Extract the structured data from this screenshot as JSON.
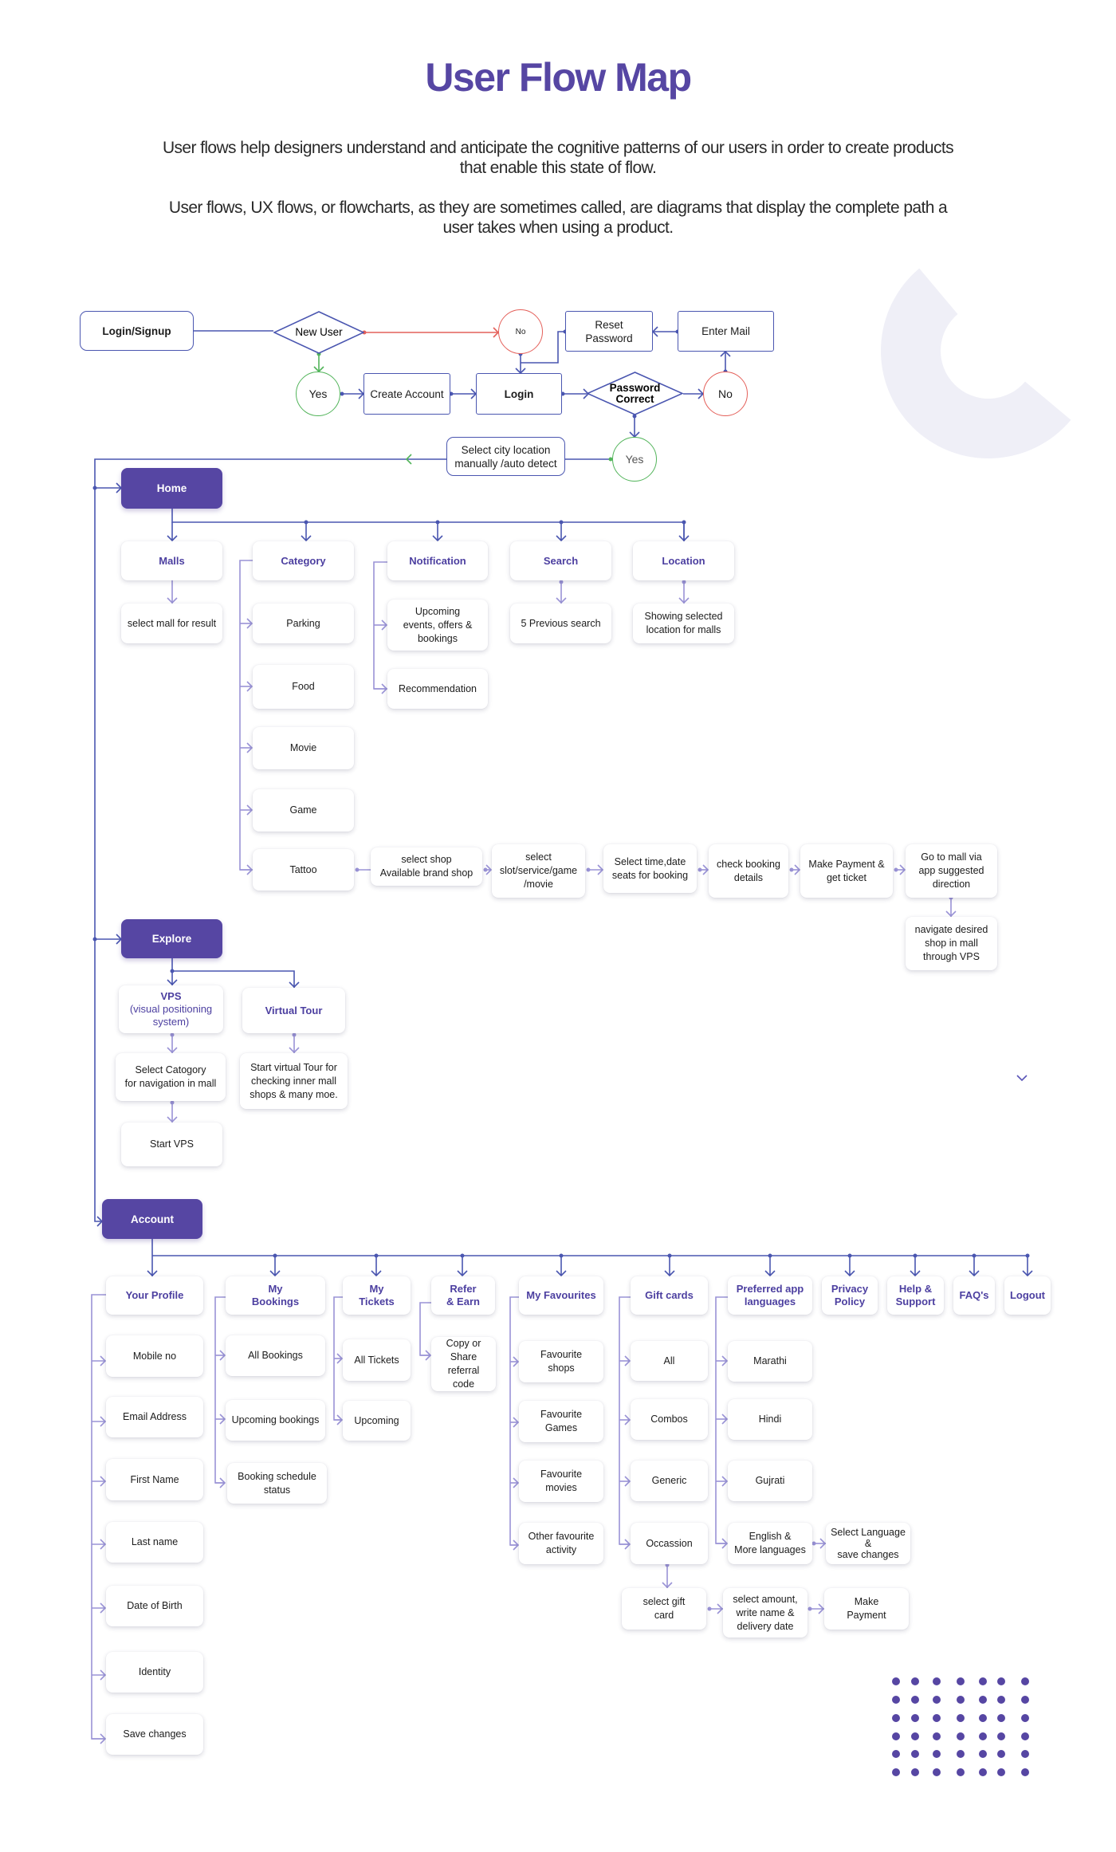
{
  "header": {
    "title": "User Flow Map",
    "paragraph_1": "User flows help designers understand and anticipate the cognitive patterns of our users in order to create products that enable this state of flow.",
    "paragraph_2": "User flows, UX flows, or flowcharts, as they are sometimes called, are diagrams that display the complete path a user takes when using a product."
  },
  "colors": {
    "primary": "#5646a3",
    "connector": "#4a56b0",
    "no_red": "#e4605a",
    "yes_green": "#52b45a",
    "decor": "#efeff7"
  },
  "auth_flow": {
    "login_signup": "Login/Signup",
    "new_user": "New User",
    "no_small": "No",
    "yes_1": "Yes",
    "create_account": "Create Account",
    "login": "Login",
    "password_correct": "Password\nCorrect",
    "no_2": "No",
    "reset_password": "Reset Password",
    "enter_mail": "Enter Mail",
    "yes_2": "Yes",
    "select_city": "Select city location\nmanually /auto detect"
  },
  "home": {
    "label": "Home",
    "sections": [
      {
        "label": "Malls",
        "items": [
          "select mall for result"
        ]
      },
      {
        "label": "Category",
        "items": [
          "Parking",
          "Food",
          "Movie",
          "Game",
          "Tattoo"
        ]
      },
      {
        "label": "Notification",
        "items": [
          "Upcoming\nevents, offers &\nbookings",
          "Recommendation"
        ]
      },
      {
        "label": "Search",
        "items": [
          "5 Previous search"
        ]
      },
      {
        "label": "Location",
        "items": [
          "Showing selected\nlocation for malls"
        ]
      }
    ],
    "booking_flow": [
      "select shop\nAvailable brand shop",
      "select\nslot/service/game\n/movie",
      "Select time,date\nseats for booking",
      "check booking\ndetails",
      "Make Payment &\nget ticket",
      "Go to mall via\napp suggested\ndirection",
      "navigate desired\nshop in mall\nthrough VPS"
    ]
  },
  "explore": {
    "label": "Explore",
    "vps": {
      "title": "VPS",
      "subtitle": "(visual positioning\nsystem)",
      "items": [
        "Select Catogory\nfor navigation in mall",
        "Start VPS"
      ]
    },
    "virtual_tour": {
      "title": "Virtual Tour",
      "items": [
        "Start  virtual Tour for\nchecking inner mall\nshops & many moe."
      ]
    }
  },
  "account": {
    "label": "Account",
    "sections": [
      {
        "label": "Your Profile",
        "items": [
          "Mobile no",
          "Email Address",
          "First Name",
          "Last name",
          "Date of Birth",
          "Identity",
          "Save changes"
        ]
      },
      {
        "label": "My\nBookings",
        "items": [
          "All Bookings",
          "Upcoming bookings",
          "Booking schedule\nstatus"
        ]
      },
      {
        "label": "My\nTickets",
        "items": [
          "All Tickets",
          "Upcoming"
        ]
      },
      {
        "label": "Refer\n& Earn",
        "items": [
          "Copy or\nShare\nreferral code"
        ]
      },
      {
        "label": "My Favourites",
        "items": [
          "Favourite\nshops",
          "Favourite\nGames",
          "Favourite\nmovies",
          "Other favourite\nactivity"
        ]
      },
      {
        "label": "Gift cards",
        "items": [
          "All",
          "Combos",
          "Generic",
          "Occassion"
        ]
      },
      {
        "label": "Preferred app\nlanguages",
        "items": [
          "Marathi",
          "Hindi",
          "Gujrati",
          "English &\nMore languages"
        ]
      },
      {
        "label": "Privacy\nPolicy",
        "items": []
      },
      {
        "label": "Help &\nSupport",
        "items": []
      },
      {
        "label": "FAQ's",
        "items": []
      },
      {
        "label": "Logout",
        "items": []
      }
    ],
    "language_next": "Select Language\n&\nsave changes",
    "gift_flow": [
      "select gift\ncard",
      "select amount,\nwrite name &\ndelivery date",
      "Make\nPayment"
    ]
  },
  "decor": {
    "chevron": "chevron-down-icon",
    "dot_grid": {
      "rows": 6,
      "cols": 7
    }
  }
}
